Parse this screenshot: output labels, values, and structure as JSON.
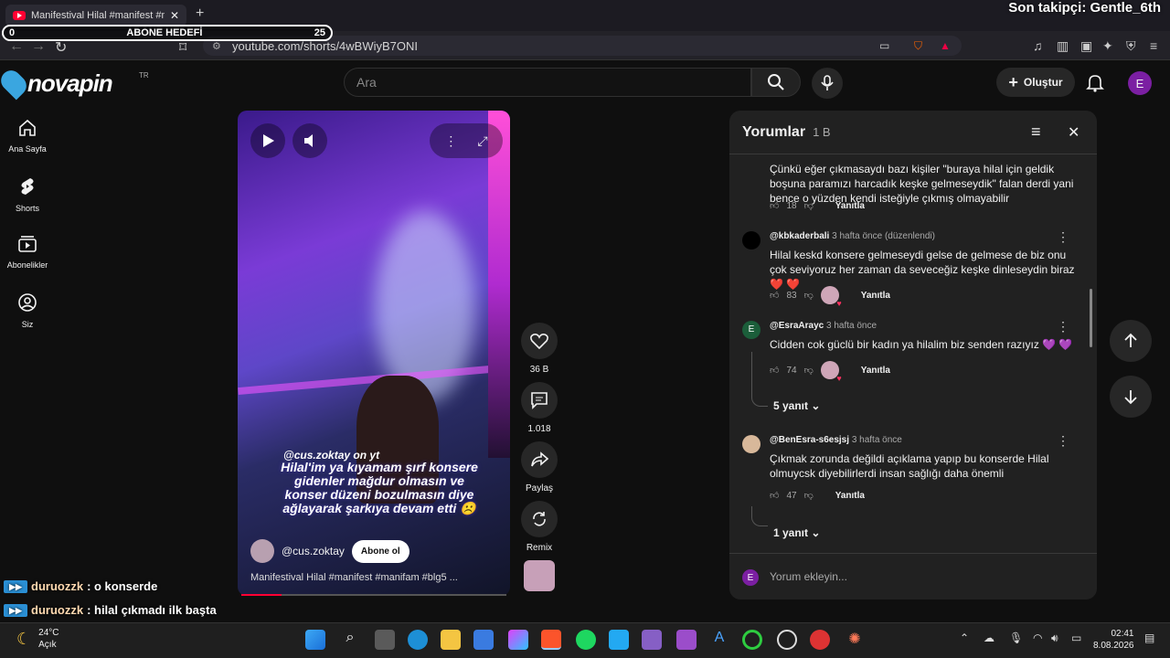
{
  "browser": {
    "tab_title": "Manifestival Hilal #manifest #ma",
    "new_tab": "+",
    "url": "youtube.com/shorts/4wBWiyB7ONI"
  },
  "overlay": {
    "follower_text": "Son takipçi: Gentle_6th",
    "goal_label": "ABONE HEDEFİ",
    "goal_current": "0",
    "goal_target": "25",
    "logo_word": "novapin",
    "logo_region": "TR",
    "chat": [
      {
        "user": "duruozzk",
        "message": ": o konserde"
      },
      {
        "user": "duruozzk",
        "message": ": hilal çıkmadı ilk başta"
      }
    ]
  },
  "header": {
    "search_placeholder": "Ara",
    "create_label": "Oluştur",
    "avatar_initial": "E"
  },
  "sidebar": {
    "items": [
      {
        "label": "Ana Sayfa",
        "icon": "home-icon"
      },
      {
        "label": "Shorts",
        "icon": "shorts-icon"
      },
      {
        "label": "Abonelikler",
        "icon": "subscriptions-icon"
      },
      {
        "label": "Siz",
        "icon": "you-icon"
      }
    ]
  },
  "video": {
    "watermark": "@cus.zoktay on yt",
    "caption": "Hilal'im ya kıyamam şırf konsere gidenler mağdur olmasın ve konser düzeni bozulmasın diye ağlayarak şarkıya devam etti ☹️",
    "channel": "@cus.zoktay",
    "subscribe_label": "Abone ol",
    "description": "Manifestival Hilal #manifest #manifam #blg5 ...",
    "progress": 0.15
  },
  "actions": {
    "likes": "36 B",
    "comments": "1.018",
    "share": "Paylaş",
    "remix": "Remix"
  },
  "comments": {
    "title": "Yorumlar",
    "count": "1 B",
    "input_placeholder": "Yorum ekleyin...",
    "input_avatar": "E",
    "items": [
      {
        "text": "Çünkü eğer çıkmasaydı bazı kişiler \"buraya hilal için geldik boşuna paramızı harcadık keşke gelmeseydik\" falan derdi yani bence o yüzden kendi isteğiyle çıkmış olmayabilir",
        "likes": "18",
        "reply_label": "Yanıtla"
      },
      {
        "author": "@kbkaderbali",
        "time": "3 hafta önce (düzenlendi)",
        "text": "Hilal keskd konsere gelmeseydi gelse de gelmese de biz onu çok seviyoruz her zaman da seveceğiz keşke dinleseydin biraz ❤️ ❤️",
        "likes": "83",
        "reply_label": "Yanıtla"
      },
      {
        "author": "@EsraAraуc",
        "time": "3 hafta önce",
        "avatar_initial": "E",
        "text": "Cidden cok güclü bir kadın ya hilalim biz senden razıyız 💜 💜",
        "likes": "74",
        "reply_label": "Yanıtla",
        "replies": "5 yanıt"
      },
      {
        "author": "@BenEsra-s6esjsj",
        "time": "3 hafta önce",
        "text": "Çıkmak zorunda değildi açıklama yapıp bu konserde Hilal olmuycsk diyebilirlerdi insan sağlığı daha önemli",
        "likes": "47",
        "reply_label": "Yanıtla",
        "replies": "1 yanıt"
      }
    ]
  },
  "taskbar": {
    "temperature": "24°C",
    "weather": "Açık",
    "time": "02:41",
    "date": "8.08.2026"
  },
  "colors": {
    "accent": "#ff0033",
    "background": "#0f0f0f",
    "panel": "#212121"
  }
}
